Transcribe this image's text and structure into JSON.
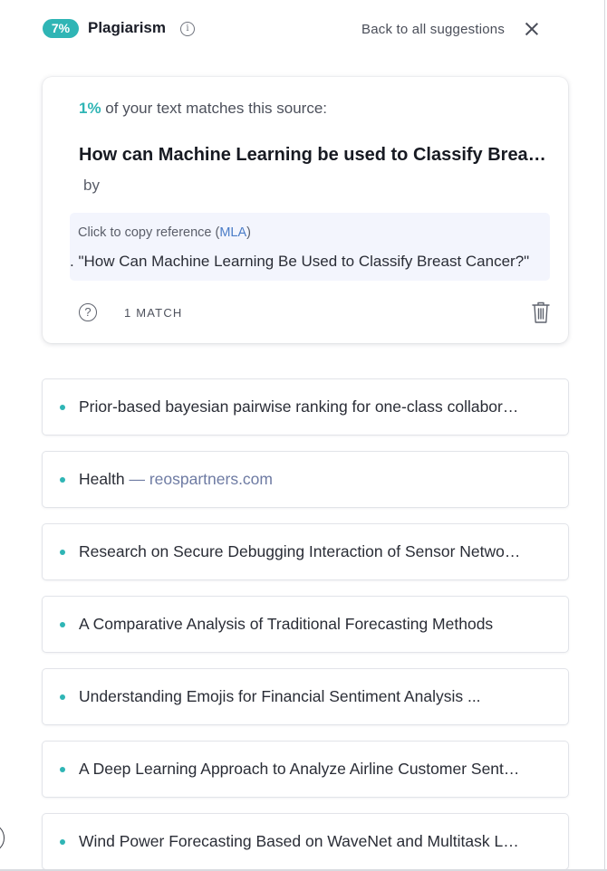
{
  "header": {
    "badge": "7%",
    "title": "Plagiarism",
    "info_icon": "i",
    "back_label": "Back to all suggestions"
  },
  "source": {
    "match_percent": "1%",
    "match_text": " of your text matches this source:",
    "title": "How can Machine Learning be used to Classify Breast Cancer?",
    "by_label": "by",
    "reference_prefix": "Click to copy reference (",
    "reference_style": "MLA",
    "reference_suffix": ")",
    "reference_text": ". \"How Can Machine Learning Be Used to Classify Breast Cancer?\"",
    "help_icon": "?",
    "match_count": "1 MATCH"
  },
  "related": [
    {
      "title": "Prior-based bayesian pairwise ranking for one-class collaborative filtering"
    },
    {
      "title": "Health",
      "separator": " — ",
      "domain": "reospartners.com"
    },
    {
      "title": "Research on Secure Debugging Interaction of Sensor Networks"
    },
    {
      "title": "A Comparative Analysis of Traditional Forecasting Methods"
    },
    {
      "title": "Understanding Emojis for Financial Sentiment Analysis ..."
    },
    {
      "title": "A Deep Learning Approach to Analyze Airline Customer Sentiment"
    },
    {
      "title": "Wind Power Forecasting Based on WaveNet and Multitask Learning"
    }
  ],
  "colors": {
    "accent_teal": "#2fb5b5",
    "link_blue": "#4a7cc7",
    "reference_bg": "#f3f5fd"
  }
}
